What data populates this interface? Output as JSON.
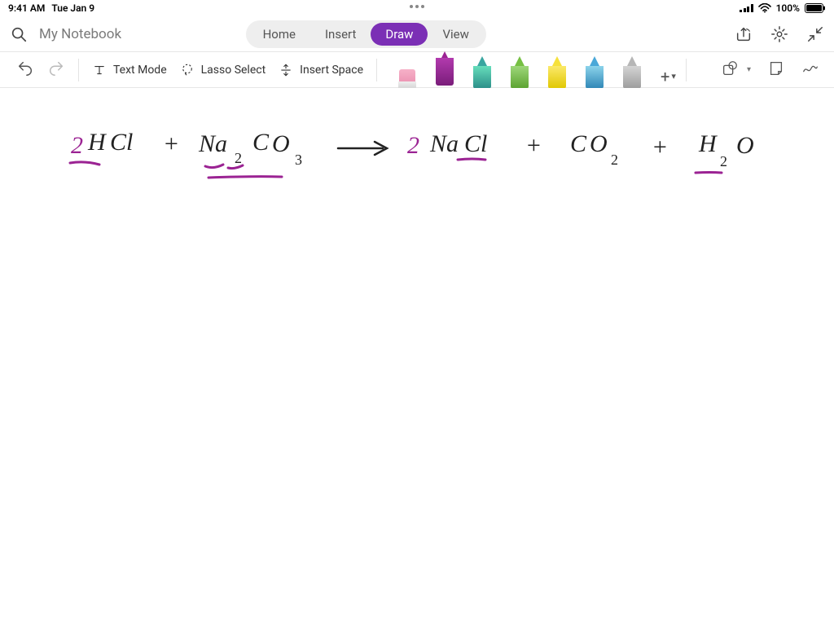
{
  "status": {
    "time": "9:41 AM",
    "date": "Tue Jan 9",
    "battery_pct": "100%"
  },
  "header": {
    "notebook_title": "My Notebook",
    "tabs": {
      "home": "Home",
      "insert": "Insert",
      "draw": "Draw",
      "view": "View"
    },
    "active_tab": "Draw"
  },
  "tools": {
    "text_mode": "Text Mode",
    "lasso_select": "Lasso Select",
    "insert_space": "Insert Space",
    "pen_names": [
      "eraser",
      "magenta-marker",
      "teal-pen",
      "green-pen",
      "yellow-highlighter",
      "blue-pen",
      "gray-pen"
    ],
    "add_pen_label": "+"
  },
  "ink": {
    "equation_text": "2HCl + Na2CO3 → 2NaCl + CO2 + H2O",
    "tokens": {
      "coef1": "2",
      "hcl_h": "H",
      "hcl_cl": "Cl",
      "plus1": "+",
      "na": "Na",
      "sub2a": "2",
      "c": "C",
      "o": "O",
      "sub3": "3",
      "arrow": "→",
      "coef2": "2",
      "na2": "Na",
      "cl2": "Cl",
      "plus2": "+",
      "c2": "C",
      "o2": "O",
      "sub2b": "2",
      "plus3": "+",
      "h2": "H",
      "sub2c": "2",
      "o3": "O"
    }
  }
}
